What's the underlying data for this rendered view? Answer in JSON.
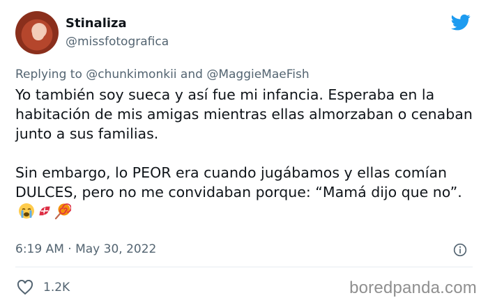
{
  "tweet": {
    "author_name": "Stinaliza",
    "author_handle": "@missfotografica",
    "reply_prefix": "Replying to",
    "reply_to_1": "@chunkimonkii",
    "reply_and": "and",
    "reply_to_2": "@MaggieMaeFish",
    "paragraph_1": "Yo también soy sueca y así fue mi infancia. Esperaba en la habitación de mis amigas mientras ellas almorzaban o cenaban junto a sus familias.",
    "paragraph_2": "Sin embargo, lo PEOR era cuando jugábamos y ellas comían DULCES, pero no me convidaban porque: “Mamá dijo que no”.",
    "emojis": [
      "crying-face-icon",
      "candy-icon",
      "lollipop-icon"
    ],
    "timestamp": "6:19 AM · May 30, 2022",
    "like_count": "1.2K"
  },
  "brand": {
    "twitter_color": "#1d9bf0",
    "watermark": "boredpanda.com"
  }
}
